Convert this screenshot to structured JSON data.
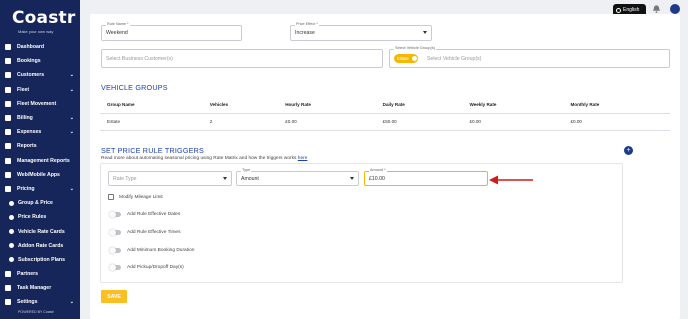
{
  "brand": {
    "name": "Coastr",
    "tagline": "Make your own way"
  },
  "topbar": {
    "language": "English"
  },
  "sidebar": {
    "items": [
      {
        "label": "Dashboard",
        "icon": "dashboard-icon",
        "chevron": false
      },
      {
        "label": "Bookings",
        "icon": "bookings-icon",
        "chevron": false
      },
      {
        "label": "Customers",
        "icon": "customers-icon",
        "chevron": true
      },
      {
        "label": "Fleet",
        "icon": "fleet-icon",
        "chevron": true
      },
      {
        "label": "Fleet Movement",
        "icon": "fleet-movement-icon",
        "chevron": false
      },
      {
        "label": "Billing",
        "icon": "billing-icon",
        "chevron": true
      },
      {
        "label": "Expenses",
        "icon": "expenses-icon",
        "chevron": true
      },
      {
        "label": "Reports",
        "icon": "reports-icon",
        "chevron": false
      },
      {
        "label": "Management Reports",
        "icon": "management-reports-icon",
        "chevron": false
      },
      {
        "label": "Web/Mobile Apps",
        "icon": "apps-icon",
        "chevron": false
      },
      {
        "label": "Pricing",
        "icon": "pricing-icon",
        "chevron": true
      },
      {
        "label": "Group & Price",
        "icon": "group-price-icon",
        "chevron": false,
        "sub": true
      },
      {
        "label": "Price Rules",
        "icon": "price-rules-icon",
        "chevron": false,
        "sub": true
      },
      {
        "label": "Vehicle Rate Cards",
        "icon": "vehicle-rate-cards-icon",
        "chevron": false,
        "sub": true
      },
      {
        "label": "Addon Rate Cards",
        "icon": "addon-rate-cards-icon",
        "chevron": false,
        "sub": true
      },
      {
        "label": "Subscription Plans",
        "icon": "subscription-plans-icon",
        "chevron": false,
        "sub": true
      },
      {
        "label": "Partners",
        "icon": "partners-icon",
        "chevron": false
      },
      {
        "label": "Task Manager",
        "icon": "task-manager-icon",
        "chevron": false
      },
      {
        "label": "Settings",
        "icon": "settings-icon",
        "chevron": true
      }
    ],
    "powered_by": "POWERED BY Coastr"
  },
  "form": {
    "rule_name": {
      "label": "Rule Name *",
      "value": "Weekend"
    },
    "price_effect": {
      "label": "Price Effect *",
      "value": "Increase"
    },
    "business_customers": {
      "placeholder": "Select Business Customer(s)"
    },
    "vehicle_groups": {
      "label": "Select Vehicle Group(s)",
      "chip": "Estate",
      "placeholder": "Select Vehicle Group(s)"
    }
  },
  "vehicle_groups": {
    "title": "VEHICLE GROUPS",
    "columns": [
      "Group Name",
      "Vehicles",
      "Hourly Rate",
      "Daily Rate",
      "Weekly Rate",
      "Monthly Rate"
    ],
    "rows": [
      [
        "Estate",
        "2",
        "£0.00",
        "£50.00",
        "£0.00",
        "£0.00"
      ]
    ]
  },
  "triggers": {
    "title": "SET PRICE RULE TRIGGERS",
    "help_text": "Read more about automating seasonal pricing using Rate Matrix and how the triggers works ",
    "help_link": "here",
    "rate_type": {
      "placeholder": "Rate Type"
    },
    "type": {
      "label": "Type",
      "value": "Amount"
    },
    "amount": {
      "label": "Amount *",
      "value": "£10.00"
    },
    "mileage_limit": "Modify Mileage Limit",
    "toggles": [
      "Add Rule Effective Dates",
      "Add Rule Effective Times",
      "Add Minimum Booking Duration",
      "Add Pickup/Dropoff Day(s)"
    ]
  },
  "actions": {
    "save": "SAVE"
  },
  "colors": {
    "sidebar": "#16265a",
    "accent": "#1e40af",
    "save": "#fbbf24",
    "highlight": "#f5b800",
    "arrow": "#d11a1a"
  }
}
